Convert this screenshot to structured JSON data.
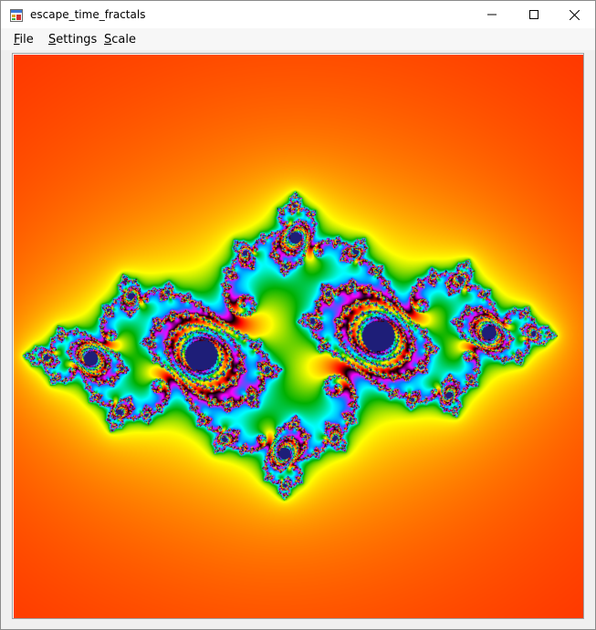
{
  "window": {
    "title": "escape_time_fractals",
    "controls": {
      "minimize": "minimize-icon",
      "maximize": "maximize-icon",
      "close": "close-icon"
    }
  },
  "menu": {
    "items": [
      {
        "label": "File",
        "mnemonic": "F",
        "rest": "ile"
      },
      {
        "label": "Settings",
        "mnemonic": "S",
        "rest": "ettings"
      },
      {
        "label": "Scale",
        "mnemonic": "S",
        "rest": "cale"
      }
    ]
  },
  "fractal": {
    "colors": [
      "#ff0000",
      "#ff8000",
      "#ffff00",
      "#00b000",
      "#00ffff",
      "#0080ff",
      "#ff00ff",
      "#000000"
    ]
  }
}
